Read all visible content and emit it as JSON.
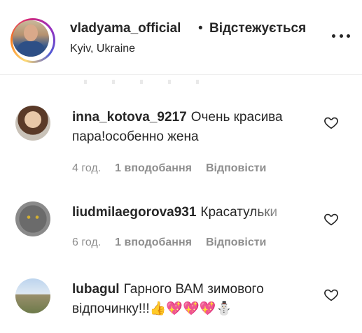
{
  "post_header": {
    "username": "vladyama_official",
    "separator": "•",
    "follow_status": "Відстежується",
    "location": "Kyiv, Ukraine"
  },
  "comments": [
    {
      "username": "inna_kotova_9217",
      "text": "Очень красива пара!особенно жена",
      "time": "4 год.",
      "likes": "1 вподобання",
      "reply": "Відповісти"
    },
    {
      "username": "liudmilaegorova931",
      "text": "Красатульки",
      "time": "6 год.",
      "likes": "1 вподобання",
      "reply": "Відповісти"
    },
    {
      "username": "lubagul",
      "text": "Гарного ВАМ зимового відпочинку!!!👍💖💖💖⛄",
      "time": "",
      "likes": "",
      "reply": ""
    }
  ],
  "icons": {
    "more": "more-options-icon",
    "heart": "heart-outline-icon"
  },
  "colors": {
    "text": "#262626",
    "secondary": "#8e8e8e"
  }
}
